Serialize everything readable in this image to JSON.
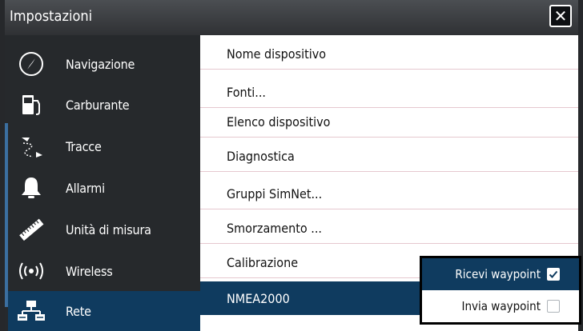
{
  "window": {
    "title": "Impostazioni",
    "close_label": "✕"
  },
  "sidebar": {
    "items": [
      {
        "label": "Navigazione",
        "icon": "compass-icon",
        "selected": false
      },
      {
        "label": "Carburante",
        "icon": "fuel-pump-icon",
        "selected": false
      },
      {
        "label": "Tracce",
        "icon": "tracks-icon",
        "selected": false
      },
      {
        "label": "Allarmi",
        "icon": "bell-icon",
        "selected": false
      },
      {
        "label": "Unità di misura",
        "icon": "ruler-icon",
        "selected": false
      },
      {
        "label": "Wireless",
        "icon": "wireless-icon",
        "selected": false
      },
      {
        "label": "Rete",
        "icon": "network-icon",
        "selected": true
      }
    ]
  },
  "content": {
    "rows": [
      {
        "label": "Nome dispositivo"
      },
      {
        "label": "Fonti..."
      },
      {
        "label": "Elenco dispositivo"
      },
      {
        "label": "Diagnostica"
      },
      {
        "label": "Gruppi SimNet..."
      },
      {
        "label": "Smorzamento ..."
      },
      {
        "label": "Calibrazione"
      },
      {
        "label": "NMEA2000",
        "selected": true
      }
    ]
  },
  "popup": {
    "items": [
      {
        "label": "Ricevi waypoint",
        "checked": true,
        "active": true
      },
      {
        "label": "Invia waypoint",
        "checked": false,
        "active": false
      }
    ]
  },
  "colors": {
    "selection": "#0f3b5f",
    "sidebar_bg": "#26292c",
    "titlebar_bg": "#3a3d41",
    "divider": "#e6c8cf"
  }
}
